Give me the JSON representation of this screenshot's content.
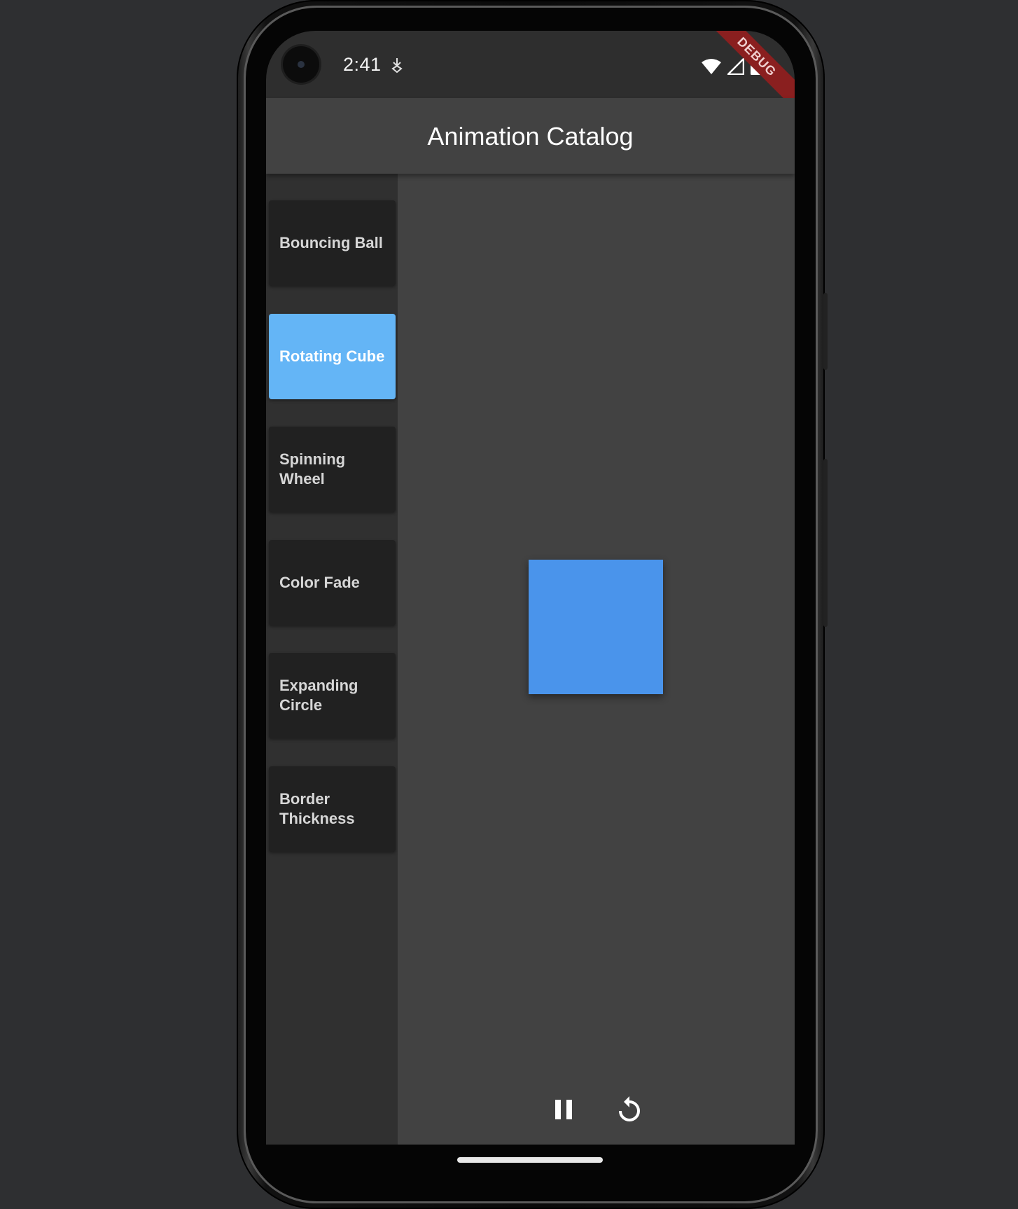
{
  "status_bar": {
    "time": "2:41",
    "notification_icon": "download-icon",
    "wifi_icon": "wifi-icon",
    "signal_icon": "signal-icon",
    "battery_icon": "battery-icon",
    "debug_label": "DEBUG"
  },
  "app_bar": {
    "title": "Animation Catalog"
  },
  "sidebar": {
    "items": [
      {
        "label": "Bouncing Ball",
        "selected": false
      },
      {
        "label": "Rotating Cube",
        "selected": true
      },
      {
        "label": "Spinning Wheel",
        "selected": false
      },
      {
        "label": "Color Fade",
        "selected": false
      },
      {
        "label": "Expanding Circle",
        "selected": false
      },
      {
        "label": "Border Thickness",
        "selected": false
      }
    ]
  },
  "animation": {
    "shape": "square",
    "color": "#4a94eb"
  },
  "controls": {
    "pause_icon": "pause-icon",
    "replay_icon": "replay-icon"
  },
  "colors": {
    "selected_item": "#64b5f6",
    "app_bar": "#424242",
    "sidebar": "#303030",
    "card": "#212121"
  }
}
